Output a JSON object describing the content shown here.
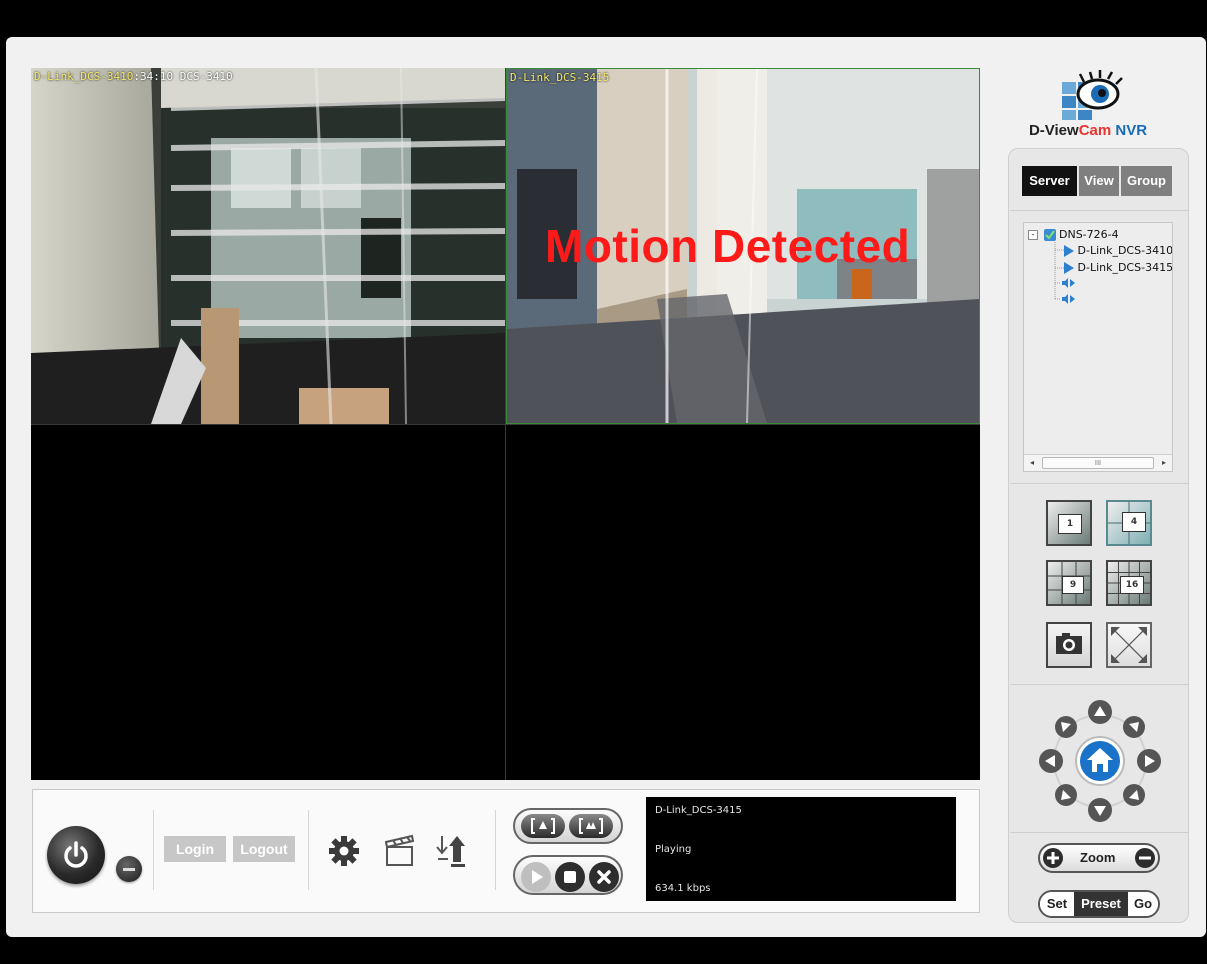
{
  "app": {
    "product": "D-View",
    "product_accent": "Cam",
    "product_suffix": " NVR"
  },
  "video": {
    "cam1": {
      "label_overlap": "D-Link_DCS-3410",
      "label_time": ":34:10 DCS-3410"
    },
    "cam2": {
      "label": "D-Link_DCS-3415",
      "overlay": "Motion Detected"
    }
  },
  "controls": {
    "login": "Login",
    "logout": "Logout"
  },
  "status": {
    "camera": "D-Link_DCS-3415",
    "state": "Playing",
    "bitrate": "634.1 kbps"
  },
  "tabs": [
    "Server",
    "View",
    "Group"
  ],
  "tree": {
    "root": "DNS-726-4",
    "cameras": [
      "D-Link_DCS-3410",
      "D-Link_DCS-3415"
    ],
    "scroll_thumb": "III"
  },
  "layout_buttons": [
    "1",
    "4",
    "9",
    "16"
  ],
  "zoom": {
    "label": "Zoom"
  },
  "preset": {
    "set": "Set",
    "preset": "Preset",
    "go": "Go"
  },
  "colors": {
    "motion": "#ff1a1a",
    "ptz_center": "#1a73c8",
    "tab_active": "#111111"
  }
}
